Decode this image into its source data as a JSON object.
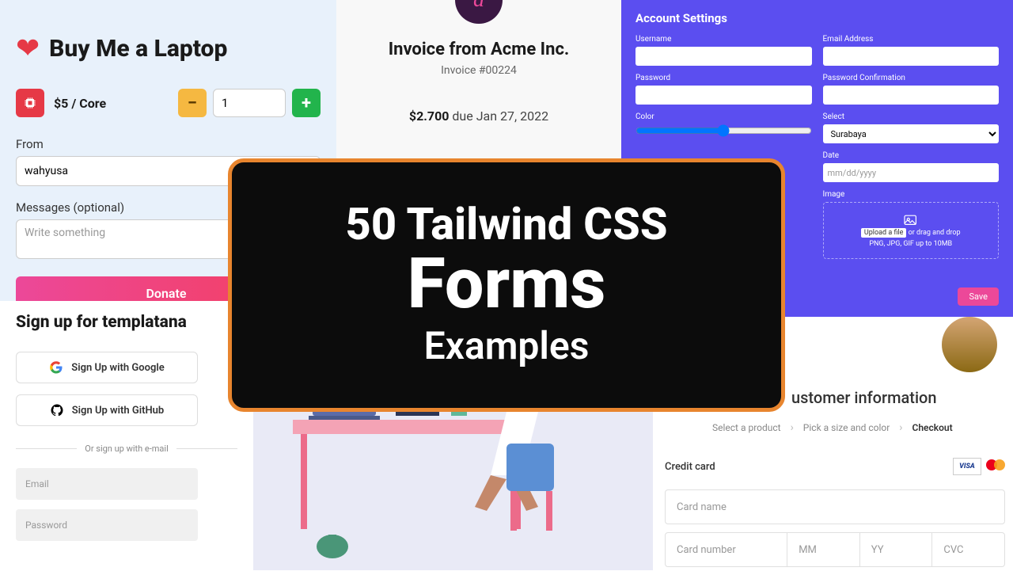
{
  "panel1": {
    "title": "Buy Me a Laptop",
    "price": "$5 / Core",
    "qty": "1",
    "from_label": "From",
    "from_value": "wahyusa",
    "messages_label": "Messages (optional)",
    "messages_placeholder": "Write something",
    "donate_button": "Donate"
  },
  "panel2": {
    "title": "Sign up for templatana",
    "google_button": "Sign Up with Google",
    "github_button": "Sign Up with GitHub",
    "divider": "Or sign up with e-mail",
    "email_placeholder": "Email",
    "password_placeholder": "Password"
  },
  "panel3": {
    "avatar_letter": "a",
    "title": "Invoice from Acme Inc.",
    "subtitle": "Invoice #00224",
    "amount": "$2.700",
    "due_text": " due Jan 27, 2022"
  },
  "panel5": {
    "title": "Account Settings",
    "labels": {
      "username": "Username",
      "email": "Email Address",
      "password": "Password",
      "password_confirm": "Password Confirmation",
      "color": "Color",
      "select": "Select",
      "date": "Date",
      "image": "Image"
    },
    "select_value": "Surabaya",
    "date_placeholder": "mm/dd/yyyy",
    "upload_text1": "Upload a file",
    "upload_text2": " or drag and drop",
    "upload_text3": "PNG, JPG, GIF up to 10MB",
    "save_button": "Save"
  },
  "panel6": {
    "title": "ustomer information",
    "steps": [
      "Select a product",
      "Pick a size and color",
      "Checkout"
    ],
    "cc_label": "Credit card",
    "visa_text": "VISA",
    "card_name_placeholder": "Card name",
    "card_number_placeholder": "Card number",
    "mm_placeholder": "MM",
    "yy_placeholder": "YY",
    "cvc_placeholder": "CVC"
  },
  "overlay": {
    "line1": "50 Tailwind CSS",
    "line2": "Forms",
    "line3": "Examples"
  }
}
